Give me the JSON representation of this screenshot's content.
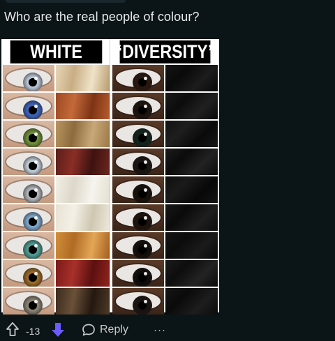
{
  "post": {
    "text": "Who are the real people of colour?"
  },
  "meme": {
    "left_header": "WHITE",
    "right_header": "“DIVERSITY”",
    "left_rows": [
      {
        "iris": "#b9c4d4",
        "hair": "linear-gradient(100deg,#e6d6b8,#c9ad84,#efe3c8,#b89a6e)"
      },
      {
        "iris": "#3d63b8",
        "hair": "linear-gradient(100deg,#9c4a22,#c4693a,#7d3415,#b75c2e)"
      },
      {
        "iris": "#6f8f3a",
        "hair": "linear-gradient(100deg,#b89560,#8e6b3d,#c8a878,#9c7848)"
      },
      {
        "iris": "#c2cbd6",
        "hair": "linear-gradient(100deg,#5a1e1a,#8a2e26,#3e1210,#6e2620)"
      },
      {
        "iris": "#b0b4b8",
        "hair": "linear-gradient(100deg,#f2efe6,#dcd7c8,#f6f4ee,#e4dfd0)"
      },
      {
        "iris": "#7fa6c8",
        "hair": "linear-gradient(100deg,#e8e2d4,#f4f0e6,#cfc7b2,#efe9dc)"
      },
      {
        "iris": "#4f9c92",
        "hair": "linear-gradient(100deg,#d28f3a,#b06b24,#e4a656,#a45e1e)"
      },
      {
        "iris": "#9a6a26",
        "hair": "linear-gradient(100deg,#7a1a1a,#a8302a,#5c1010,#92241e)"
      },
      {
        "iris": "#8a8272",
        "hair": "linear-gradient(100deg,#3a2a1e,#6a5038,#241810,#4e3a28)"
      }
    ],
    "right_rows": [
      {
        "iris": "#2a170e",
        "hair": "linear-gradient(135deg,#151515,#0a0a0a,#1c1c1c,#080808)"
      },
      {
        "iris": "#1c120c",
        "hair": "linear-gradient(135deg,#1a1a1a,#0c0c0c,#202020,#0a0a0a)"
      },
      {
        "iris": "#12241c",
        "hair": "linear-gradient(135deg,#121212,#1e1e1e,#0a0a0a,#181818)"
      },
      {
        "iris": "#1a1412",
        "hair": "linear-gradient(135deg,#1c1c1c,#0b0b0b,#222,#0c0c0c)"
      },
      {
        "iris": "#160e08",
        "hair": "linear-gradient(135deg,#101010,#1a1a1a,#080808,#141414)"
      },
      {
        "iris": "#1e120a",
        "hair": "linear-gradient(135deg,#181818,#0a0a0a,#1e1e1e,#0e0e0e)"
      },
      {
        "iris": "#120c08",
        "hair": "linear-gradient(135deg,#141414,#0c0c0c,#1a1a1a,#090909)"
      },
      {
        "iris": "#0e0a08",
        "hair": "linear-gradient(135deg,#1b1b1b,#0d0d0d,#232323,#0b0b0b)"
      },
      {
        "iris": "#1a1210",
        "hair": "linear-gradient(135deg,#161616,#0a0a0a,#1d1d1d,#0c0c0c)"
      }
    ]
  },
  "actions": {
    "upvote_icon": "arrow-up-outline",
    "vote_count": "-13",
    "downvote_icon": "arrow-down-filled",
    "downvote_color": "#6a5cff",
    "reply_icon": "speech-bubble-outline",
    "reply_label": "Reply",
    "more_label": "···"
  }
}
